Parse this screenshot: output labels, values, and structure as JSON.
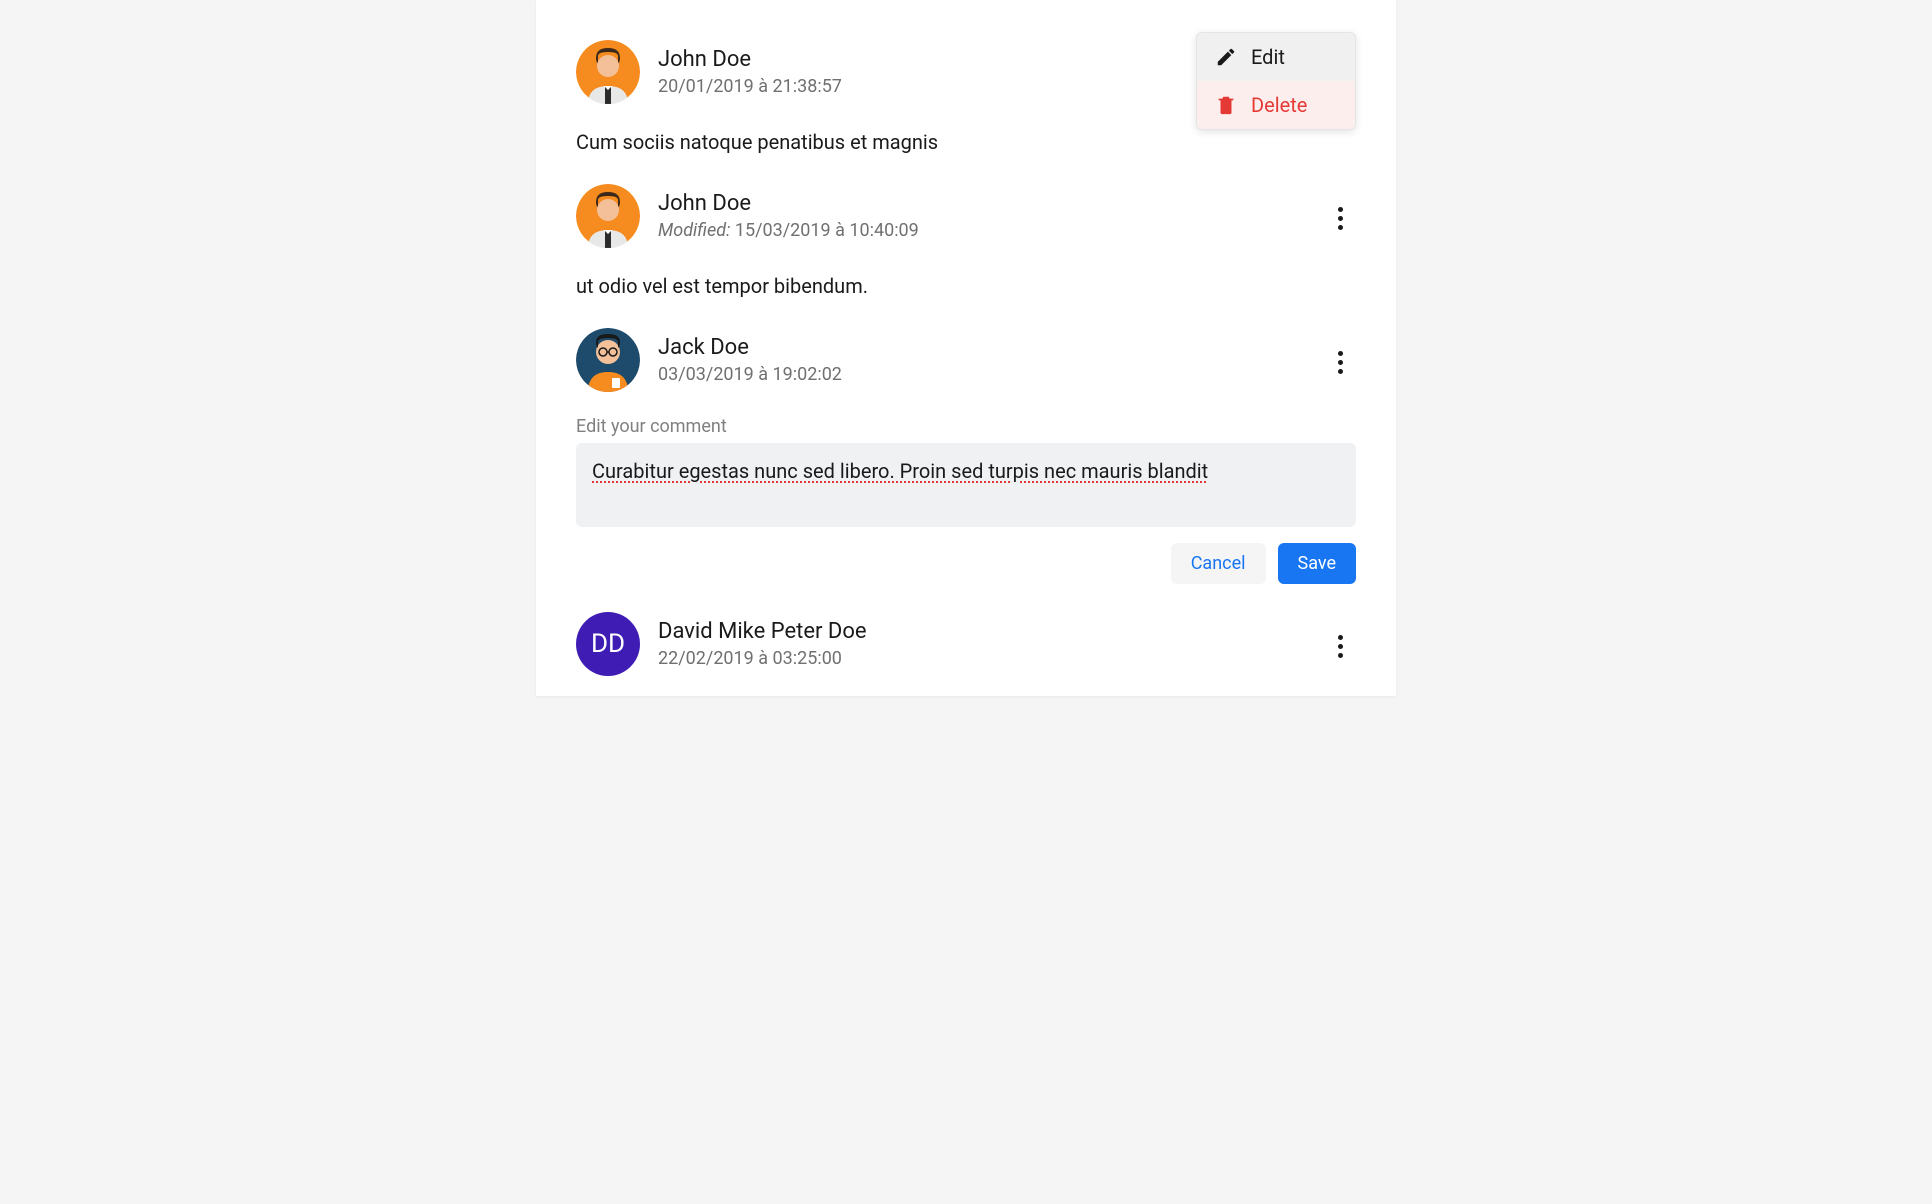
{
  "menu": {
    "edit_label": "Edit",
    "delete_label": "Delete"
  },
  "edit_form": {
    "label": "Edit your comment",
    "value": "Curabitur egestas nunc sed libero. Proin sed turpis nec mauris blandit",
    "cancel_label": "Cancel",
    "save_label": "Save"
  },
  "comments": [
    {
      "author": "John Doe",
      "timestamp": "20/01/2019 à 21:38:57",
      "modified_prefix": "",
      "body": "Cum sociis natoque penatibus et magnis",
      "avatar_initials": ""
    },
    {
      "author": "John Doe",
      "timestamp": "15/03/2019 à 10:40:09",
      "modified_prefix": "Modified:",
      "body": "ut odio vel est tempor bibendum.",
      "avatar_initials": ""
    },
    {
      "author": "Jack Doe",
      "timestamp": "03/03/2019 à 19:02:02",
      "modified_prefix": "",
      "body": "",
      "avatar_initials": ""
    },
    {
      "author": "David Mike Peter Doe",
      "timestamp": "22/02/2019 à 03:25:00",
      "modified_prefix": "",
      "body": "",
      "avatar_initials": "DD"
    }
  ]
}
